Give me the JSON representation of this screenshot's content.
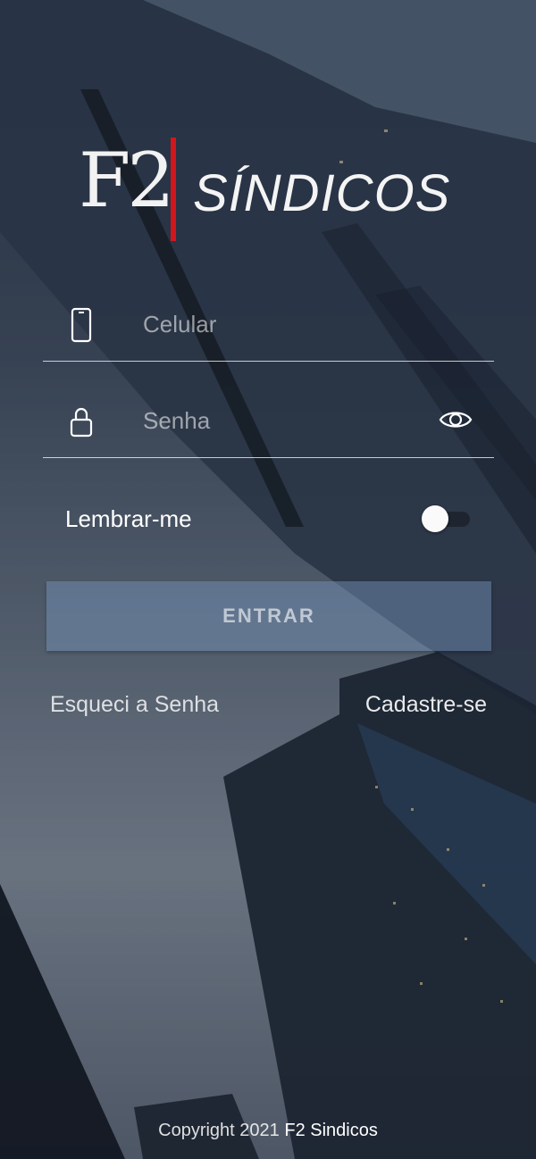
{
  "logo": {
    "mark": "F2",
    "name": "SÍNDICOS",
    "accent_color": "#d3161b"
  },
  "form": {
    "phone": {
      "placeholder": "Celular",
      "value": "",
      "icon": "smartphone-icon"
    },
    "password": {
      "placeholder": "Senha",
      "value": "",
      "icon": "lock-icon",
      "toggle_icon": "eye-icon"
    },
    "remember_label": "Lembrar-me",
    "remember_on": false,
    "submit_label": "ENTRAR"
  },
  "links": {
    "forgot": "Esqueci a Senha",
    "register": "Cadastre-se"
  },
  "footer": {
    "copyright_prefix": "Copyright 2021",
    "company": "F2 Sindicos"
  }
}
